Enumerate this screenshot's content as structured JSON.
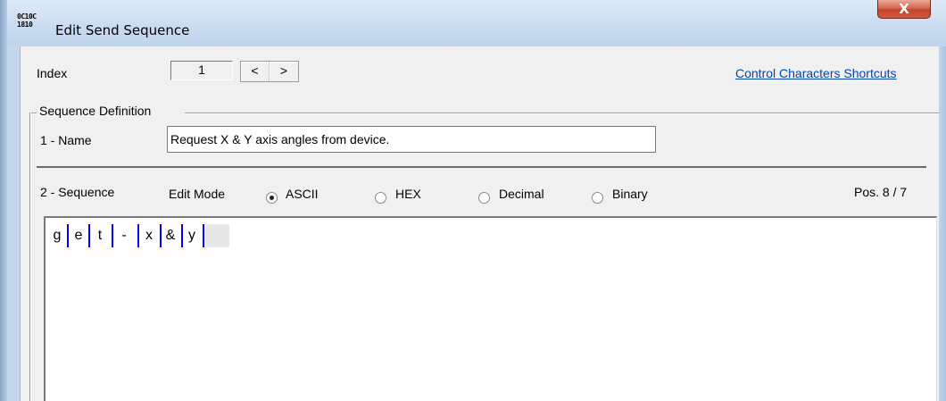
{
  "window": {
    "title": "Edit Send Sequence",
    "icon_text_top": "0C10C",
    "icon_text_bottom": "1810",
    "close_label": "X"
  },
  "index": {
    "label": "Index",
    "value": "1",
    "prev_label": "<",
    "next_label": ">"
  },
  "shortcuts_link": "Control Characters Shortcuts",
  "definition": {
    "group_label": "Sequence Definition",
    "name_label": "1 - Name",
    "name_value": "Request X & Y axis angles from device."
  },
  "sequence": {
    "label": "2 - Sequence",
    "edit_mode_label": "Edit Mode",
    "modes": [
      "ASCII",
      "HEX",
      "Decimal",
      "Binary"
    ],
    "selected_mode": "ASCII",
    "position": "Pos. 8 / 7",
    "chars": [
      "g",
      "e",
      "t",
      "-",
      "x",
      "&",
      "y"
    ]
  }
}
